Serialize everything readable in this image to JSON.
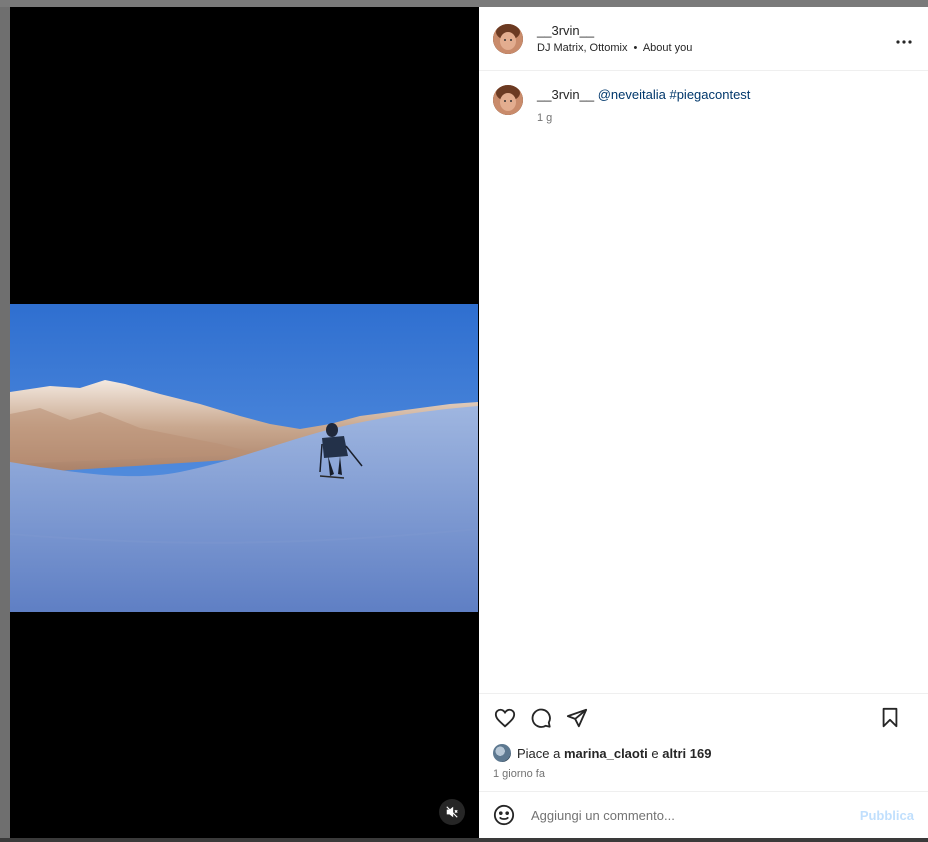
{
  "post": {
    "username": "__3rvin__",
    "audio_artists": "DJ Matrix, Ottomix",
    "separator": "•",
    "about_link": "About you"
  },
  "caption": {
    "username": "__3rvin__",
    "text": "@neveitalia #piegacontest",
    "age": "1 g"
  },
  "likes": {
    "prefix": "Piace a ",
    "user": "marina_claoti",
    "middle": " e ",
    "others": "altri 169"
  },
  "date_label": "1 giorno fa",
  "comment_box": {
    "placeholder": "Aggiungi un commento...",
    "publish_label": "Pubblica"
  },
  "icons": {
    "more": "more-options-icon",
    "like": "heart-icon",
    "comment": "comment-icon",
    "share": "share-icon",
    "save": "bookmark-icon",
    "emoji": "emoji-icon",
    "mute": "muted-speaker-icon"
  },
  "colors": {
    "link": "#00376b",
    "publish_disabled": "#c0dffd",
    "secondary_text": "#737373"
  }
}
